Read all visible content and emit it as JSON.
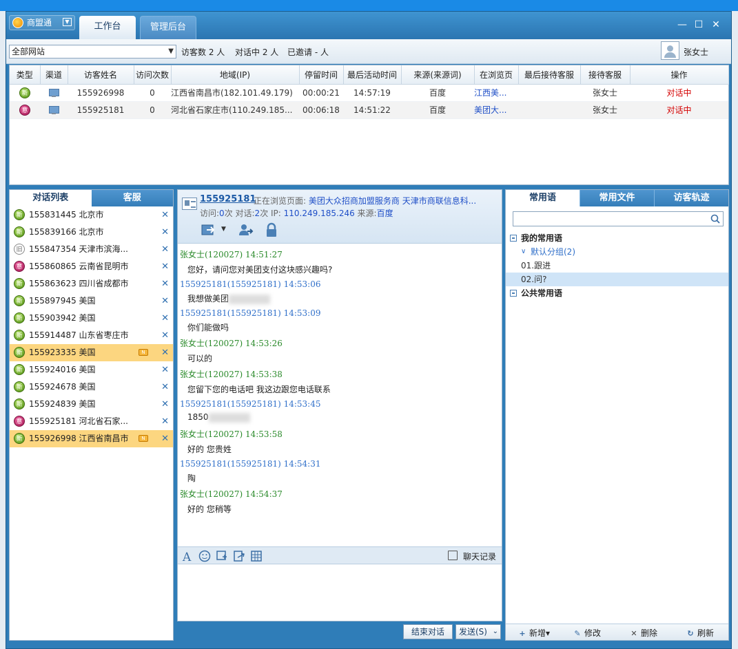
{
  "app": {
    "name": "商盟通"
  },
  "tabs": [
    {
      "label": "工作台"
    },
    {
      "label": "管理后台"
    }
  ],
  "toolbar": {
    "site_select": "全部网站",
    "visitor_count": "访客数 2 人",
    "in_conversation": "对话中 2 人",
    "invited": "已邀请 - 人",
    "user_name": "张女士"
  },
  "visitor_table": {
    "columns": [
      "类型",
      "渠道",
      "访客姓名",
      "访问次数",
      "地域(IP)",
      "停留时间",
      "最后活动时间",
      "来源(来源词)",
      "在浏览页",
      "最后接待客服",
      "接待客服",
      "操作"
    ],
    "rows": [
      {
        "type": "新",
        "name": "155926998",
        "visits": "0",
        "region": "江西省南昌市(182.101.49.179)",
        "stay": "00:00:21",
        "last_active": "14:57:19",
        "source": "百度",
        "page": "江西美...",
        "last_agent": "",
        "agent": "张女士",
        "op": "对话中"
      },
      {
        "type": "意",
        "name": "155925181",
        "visits": "0",
        "region": "河北省石家庄市(110.249.185...",
        "stay": "00:06:18",
        "last_active": "14:51:22",
        "source": "百度",
        "page": "美团大...",
        "last_agent": "",
        "agent": "张女士",
        "op": "对话中"
      }
    ]
  },
  "left_panel": {
    "tabs": [
      {
        "label": "对话列表"
      },
      {
        "label": "客服"
      }
    ],
    "conversations": [
      {
        "badge": "新",
        "id": "155831445",
        "region": "北京市"
      },
      {
        "badge": "新",
        "id": "155839166",
        "region": "北京市"
      },
      {
        "badge": "旧",
        "id": "155847354",
        "region": "天津市滨海..."
      },
      {
        "badge": "意",
        "id": "155860865",
        "region": "云南省昆明市"
      },
      {
        "badge": "新",
        "id": "155863623",
        "region": "四川省成都市"
      },
      {
        "badge": "新",
        "id": "155897945",
        "region": "美国"
      },
      {
        "badge": "新",
        "id": "155903942",
        "region": "美国"
      },
      {
        "badge": "新",
        "id": "155914487",
        "region": "山东省枣庄市"
      },
      {
        "badge": "新",
        "id": "155923335",
        "region": "美国"
      },
      {
        "badge": "新",
        "id": "155924016",
        "region": "美国"
      },
      {
        "badge": "新",
        "id": "155924678",
        "region": "美国"
      },
      {
        "badge": "新",
        "id": "155924839",
        "region": "美国"
      },
      {
        "badge": "意",
        "id": "155925181",
        "region": "河北省石家..."
      },
      {
        "badge": "新",
        "id": "155926998",
        "region": "江西省南昌市"
      }
    ]
  },
  "chat": {
    "visitor_id": "155925181",
    "browsing_label": "正在浏览页面:",
    "browsing_page": "美团大众招商加盟服务商  天津市商联信息科...",
    "meta": {
      "visits_label": "访问:",
      "visits": "0",
      "visits_unit": "次 对话:",
      "dialogs": "2",
      "dialogs_unit": "次 IP:",
      "ip": "110.249.185.246",
      "source_label": "来源:",
      "source": "百度"
    },
    "messages": [
      {
        "who": "agent",
        "head": "张女士(120027)  14:51:27",
        "text": "您好，请问您对美团支付这块感兴趣吗?"
      },
      {
        "who": "visitor",
        "head": "155925181(155925181)  14:53:06",
        "text": "我想做美团"
      },
      {
        "who": "visitor",
        "head": "155925181(155925181)  14:53:09",
        "text": "你们能做吗"
      },
      {
        "who": "agent",
        "head": "张女士(120027)  14:53:26",
        "text": "可以的"
      },
      {
        "who": "agent",
        "head": "张女士(120027)  14:53:38",
        "text": "您留下您的电话吧    我这边跟您电话联系"
      },
      {
        "who": "visitor",
        "head": "155925181(155925181)  14:53:45",
        "text": "1850"
      },
      {
        "who": "agent",
        "head": "张女士(120027)  14:53:58",
        "text": "好的    您贵姓"
      },
      {
        "who": "visitor",
        "head": "155925181(155925181)  14:54:31",
        "text": "陶"
      },
      {
        "who": "agent",
        "head": "张女士(120027)  14:54:37",
        "text": "好的    您稍等"
      }
    ],
    "history_label": "聊天记录",
    "end_button": "结束对话",
    "send_button": "发送(S)"
  },
  "right_panel": {
    "tabs": [
      {
        "label": "常用语"
      },
      {
        "label": "常用文件"
      },
      {
        "label": "访客轨迹"
      }
    ],
    "search_placeholder": "",
    "tree": {
      "my_group": "我的常用语",
      "default_group": "默认分组(2)",
      "items": [
        "01.跟进",
        "02.问?"
      ],
      "public_group": "公共常用语"
    },
    "actions": {
      "add": "新增",
      "edit": "修改",
      "delete": "删除",
      "refresh": "刷新"
    }
  },
  "colors": {
    "accent": "#2f7db8",
    "link": "#1f4fc7",
    "op_red": "#d40000",
    "selected": "#fcd680",
    "agent_green": "#2a8a2a",
    "visitor_blue": "#2f6fc9"
  }
}
